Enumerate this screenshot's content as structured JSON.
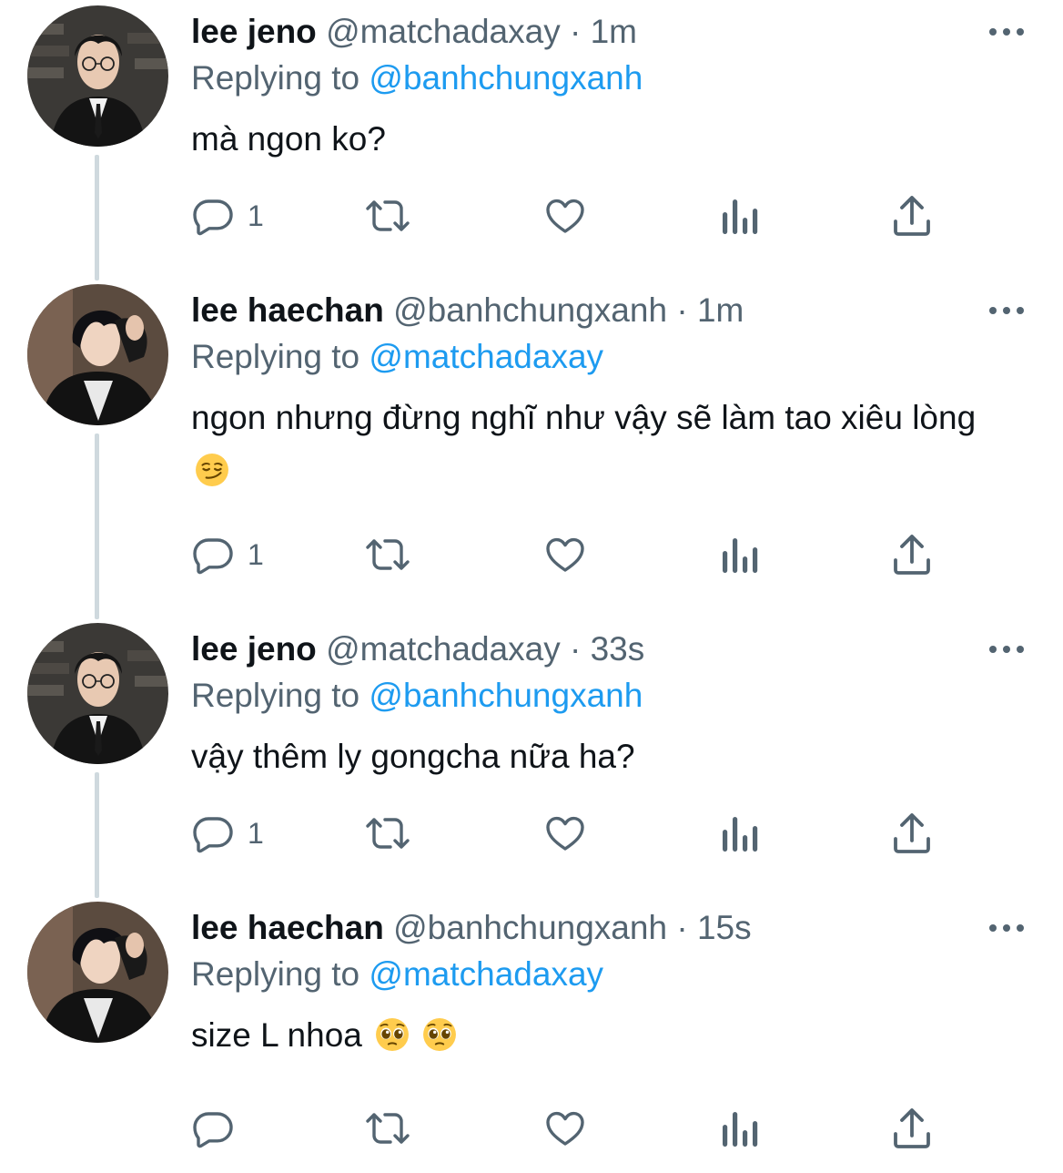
{
  "colors": {
    "text_primary": "#0f1419",
    "text_secondary": "#536471",
    "mention": "#1d9bf0",
    "thread_line": "#cfd9de"
  },
  "tweets": [
    {
      "name": "lee jeno",
      "handle": "@matchadaxay",
      "separator": "·",
      "time": "1m",
      "replying_label": "Replying to",
      "replying_to": "@banhchungxanh",
      "text": "mà ngon ko?",
      "emojis": [],
      "reply_count": "1",
      "avatar_icon": "avatar-photo-icon"
    },
    {
      "name": "lee haechan",
      "handle": "@banhchungxanh",
      "separator": "·",
      "time": "1m",
      "replying_label": "Replying to",
      "replying_to": "@matchadaxay",
      "text": "ngon nhưng đừng nghĩ như vậy sẽ làm tao xiêu lòng",
      "emojis": [
        "smirking-face-emoji"
      ],
      "reply_count": "1",
      "avatar_icon": "avatar-photo-icon"
    },
    {
      "name": "lee jeno",
      "handle": "@matchadaxay",
      "separator": "·",
      "time": "33s",
      "replying_label": "Replying to",
      "replying_to": "@banhchungxanh",
      "text": "vậy thêm ly gongcha nữa ha?",
      "emojis": [],
      "reply_count": "1",
      "avatar_icon": "avatar-photo-icon"
    },
    {
      "name": "lee haechan",
      "handle": "@banhchungxanh",
      "separator": "·",
      "time": "15s",
      "replying_label": "Replying to",
      "replying_to": "@matchadaxay",
      "text": "size L nhoa",
      "emojis": [
        "pleading-face-emoji",
        "pleading-face-emoji"
      ],
      "reply_count": "",
      "avatar_icon": "avatar-photo-icon"
    }
  ],
  "action_icons": [
    "reply-icon",
    "retweet-icon",
    "like-icon",
    "analytics-icon",
    "share-icon"
  ],
  "more_icon": "more-options-icon"
}
